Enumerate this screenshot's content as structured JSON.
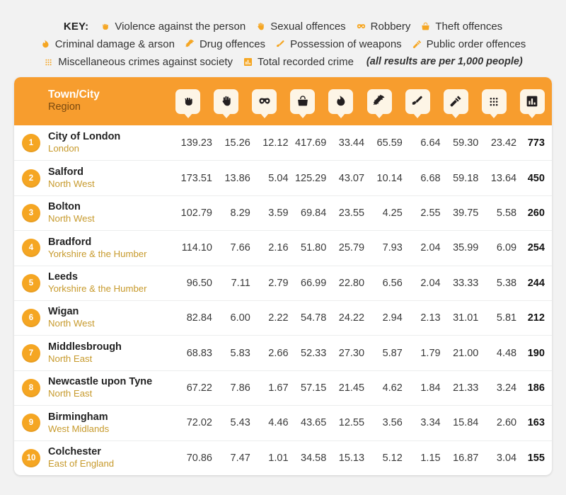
{
  "legend": {
    "key_label": "KEY:",
    "note": "(all results are per 1,000 people)",
    "rows": [
      [
        {
          "icon": "fist-icon",
          "label": "Violence against the person"
        },
        {
          "icon": "hand-icon",
          "label": "Sexual offences"
        },
        {
          "icon": "mask-icon",
          "label": "Robbery"
        },
        {
          "icon": "handbag-icon",
          "label": "Theft offences"
        }
      ],
      [
        {
          "icon": "flame-icon",
          "label": "Criminal damage & arson"
        },
        {
          "icon": "syringe-icon",
          "label": "Drug offences"
        },
        {
          "icon": "knife-icon",
          "label": "Possession of weapons"
        },
        {
          "icon": "gavel-icon",
          "label": "Public order offences"
        }
      ],
      [
        {
          "icon": "dots-grid-icon",
          "label": "Miscellaneous crimes against society"
        },
        {
          "icon": "bar-chart-icon",
          "label": "Total recorded crime"
        }
      ]
    ]
  },
  "table": {
    "header": {
      "name_line1": "Town/City",
      "name_line2": "Region",
      "columns": [
        {
          "icon": "fist-icon",
          "name": "Violence against the person"
        },
        {
          "icon": "hand-icon",
          "name": "Sexual offences"
        },
        {
          "icon": "mask-icon",
          "name": "Robbery"
        },
        {
          "icon": "handbag-icon",
          "name": "Theft offences"
        },
        {
          "icon": "flame-icon",
          "name": "Criminal damage & arson"
        },
        {
          "icon": "syringe-icon",
          "name": "Drug offences"
        },
        {
          "icon": "knife-icon",
          "name": "Possession of weapons"
        },
        {
          "icon": "gavel-icon",
          "name": "Public order offences"
        },
        {
          "icon": "dots-grid-icon",
          "name": "Miscellaneous crimes against society"
        },
        {
          "icon": "bar-chart-icon",
          "name": "Total recorded crime"
        }
      ]
    },
    "rows": [
      {
        "rank": "1",
        "city": "City of London",
        "region": "London",
        "values": [
          "139.23",
          "15.26",
          "12.12",
          "417.69",
          "33.44",
          "65.59",
          "6.64",
          "59.30",
          "23.42"
        ],
        "total": "773"
      },
      {
        "rank": "2",
        "city": "Salford",
        "region": "North West",
        "values": [
          "173.51",
          "13.86",
          "5.04",
          "125.29",
          "43.07",
          "10.14",
          "6.68",
          "59.18",
          "13.64"
        ],
        "total": "450"
      },
      {
        "rank": "3",
        "city": "Bolton",
        "region": "North West",
        "values": [
          "102.79",
          "8.29",
          "3.59",
          "69.84",
          "23.55",
          "4.25",
          "2.55",
          "39.75",
          "5.58"
        ],
        "total": "260"
      },
      {
        "rank": "4",
        "city": "Bradford",
        "region": "Yorkshire & the Humber",
        "values": [
          "114.10",
          "7.66",
          "2.16",
          "51.80",
          "25.79",
          "7.93",
          "2.04",
          "35.99",
          "6.09"
        ],
        "total": "254"
      },
      {
        "rank": "5",
        "city": "Leeds",
        "region": "Yorkshire & the Humber",
        "values": [
          "96.50",
          "7.11",
          "2.79",
          "66.99",
          "22.80",
          "6.56",
          "2.04",
          "33.33",
          "5.38"
        ],
        "total": "244"
      },
      {
        "rank": "6",
        "city": "Wigan",
        "region": "North West",
        "values": [
          "82.84",
          "6.00",
          "2.22",
          "54.78",
          "24.22",
          "2.94",
          "2.13",
          "31.01",
          "5.81"
        ],
        "total": "212"
      },
      {
        "rank": "7",
        "city": "Middlesbrough",
        "region": "North East",
        "values": [
          "68.83",
          "5.83",
          "2.66",
          "52.33",
          "27.30",
          "5.87",
          "1.79",
          "21.00",
          "4.48"
        ],
        "total": "190"
      },
      {
        "rank": "8",
        "city": "Newcastle upon Tyne",
        "region": "North East",
        "values": [
          "67.22",
          "7.86",
          "1.67",
          "57.15",
          "21.45",
          "4.62",
          "1.84",
          "21.33",
          "3.24"
        ],
        "total": "186"
      },
      {
        "rank": "9",
        "city": "Birmingham",
        "region": "West Midlands",
        "values": [
          "72.02",
          "5.43",
          "4.46",
          "43.65",
          "12.55",
          "3.56",
          "3.34",
          "15.84",
          "2.60"
        ],
        "total": "163"
      },
      {
        "rank": "10",
        "city": "Colchester",
        "region": "East of England",
        "values": [
          "70.86",
          "7.47",
          "1.01",
          "34.58",
          "15.13",
          "5.12",
          "1.15",
          "16.87",
          "3.04"
        ],
        "total": "155"
      }
    ]
  },
  "colors": {
    "header_orange": "#f79d2e",
    "badge_orange": "#f5a623",
    "region_text": "#c79a2c",
    "bubble_cream": "#fdf5e6",
    "page_background": "#f2f2f2"
  }
}
